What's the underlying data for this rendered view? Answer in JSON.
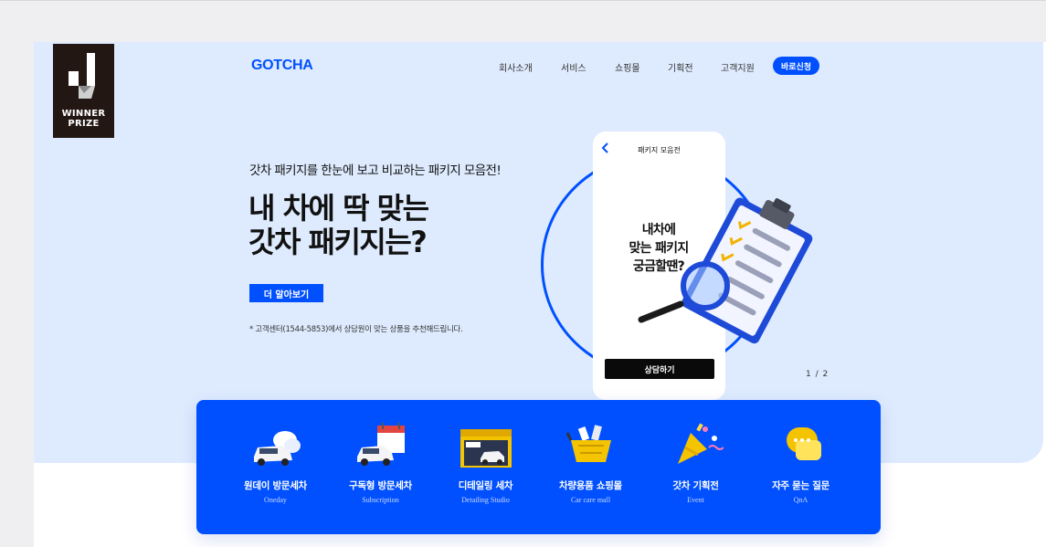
{
  "award": {
    "line1": "WINNER",
    "line2": "PRIZE"
  },
  "header": {
    "logo": "GOTCHA",
    "nav": [
      "회사소개",
      "서비스",
      "쇼핑몰",
      "기획전",
      "고객지원"
    ],
    "apply_label": "바로신청"
  },
  "hero": {
    "subtitle": "갓차 패키지를 한눈에 보고 비교하는 패키지 모음전!",
    "headline_line1": "내 차에 딱 맞는",
    "headline_line2": "갓차 패키지는?",
    "more_label": "더 알아보기",
    "notice": "* 고객센터(1544-5853)에서 상담원이 맞는 상품을 추천해드립니다.",
    "pager": "1 / 2"
  },
  "phone": {
    "title": "패키지 모음전",
    "question_line1": "내차에",
    "question_line2": "맞는 패키지",
    "question_line3": "궁금할땐?",
    "cta_label": "상담하기"
  },
  "services": [
    {
      "title": "원데이 방문세차",
      "subtitle": "Oneday",
      "icon": "car-wash-icon"
    },
    {
      "title": "구독형 방문세차",
      "subtitle": "Subscription",
      "icon": "calendar-car-icon"
    },
    {
      "title": "디테일링 세차",
      "subtitle": "Detailing Studio",
      "icon": "store-icon"
    },
    {
      "title": "차량용품 쇼핑몰",
      "subtitle": "Car care mall",
      "icon": "shopping-basket-icon"
    },
    {
      "title": "갓차 기획전",
      "subtitle": "Event",
      "icon": "party-popper-icon"
    },
    {
      "title": "자주 묻는 질문",
      "subtitle": "QnA",
      "icon": "chat-bubble-icon"
    }
  ],
  "colors": {
    "brand": "#0050ff",
    "hero_bg": "#deebfe",
    "dark": "#231714"
  }
}
